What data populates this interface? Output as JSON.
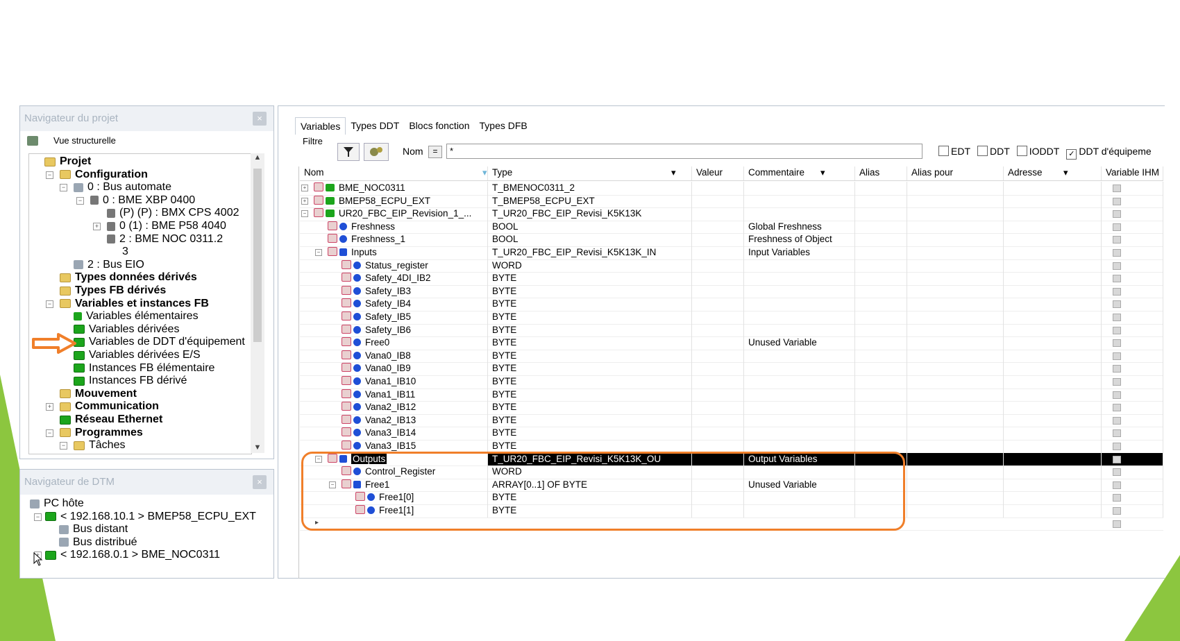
{
  "project_nav": {
    "title": "Navigateur du projet",
    "close": "×",
    "view_label": "Vue structurelle",
    "nodes": [
      {
        "label": "Projet",
        "bold": true
      },
      {
        "label": "Configuration",
        "bold": true
      },
      {
        "label": "0 : Bus automate"
      },
      {
        "label": "0 : BME XBP 0400"
      },
      {
        "label": "(P) (P) : BMX CPS 4002"
      },
      {
        "label": "0 (1) : BME P58 4040"
      },
      {
        "label": "2 : BME NOC 0311.2"
      },
      {
        "label": "3"
      },
      {
        "label": "2 : Bus EIO"
      },
      {
        "label": "Types données dérivés",
        "bold": true
      },
      {
        "label": "Types FB dérivés",
        "bold": true
      },
      {
        "label": "Variables et instances FB",
        "bold": true
      },
      {
        "label": "Variables élémentaires"
      },
      {
        "label": "Variables dérivées"
      },
      {
        "label": "Variables de DDT d'équipement"
      },
      {
        "label": "Variables dérivées E/S"
      },
      {
        "label": "Instances FB élémentaire"
      },
      {
        "label": "Instances FB dérivé"
      },
      {
        "label": "Mouvement",
        "bold": true
      },
      {
        "label": "Communication",
        "bold": true
      },
      {
        "label": "Réseau Ethernet",
        "bold": true
      },
      {
        "label": "Programmes",
        "bold": true
      },
      {
        "label": "Tâches"
      }
    ]
  },
  "dtm_nav": {
    "title": "Navigateur de DTM",
    "close": "×",
    "nodes": [
      {
        "label": "PC hôte"
      },
      {
        "label": "< 192.168.10.1 > BMEP58_ECPU_EXT"
      },
      {
        "label": "Bus distant"
      },
      {
        "label": "Bus distribué"
      },
      {
        "label": "< 192.168.0.1 > BME_NOC0311"
      }
    ]
  },
  "editor": {
    "tabs": [
      "Variables",
      "Types DDT",
      "Blocs fonction",
      "Types DFB"
    ],
    "filter_label": "Filtre",
    "name_label": "Nom",
    "equals": "=",
    "filter_value": "*",
    "checkboxes": [
      {
        "label": "EDT",
        "checked": false
      },
      {
        "label": "DDT",
        "checked": false
      },
      {
        "label": "IODDT",
        "checked": false
      },
      {
        "label": "DDT d'équipeme",
        "checked": true
      }
    ],
    "columns": [
      "Nom",
      "Type",
      "Valeur",
      "Commentaire",
      "Alias",
      "Alias pour",
      "Adresse",
      "Variable IHM"
    ],
    "rows": [
      {
        "name": "BME_NOC0311",
        "type": "T_BMENOC0311_2",
        "comment": "",
        "level": 0,
        "exp": "+",
        "icon": "green"
      },
      {
        "name": "BMEP58_ECPU_EXT",
        "type": "T_BMEP58_ECPU_EXT",
        "comment": "",
        "level": 0,
        "exp": "+",
        "icon": "green"
      },
      {
        "name": "UR20_FBC_EIP_Revision_1_...",
        "type": "T_UR20_FBC_EIP_Revisi_K5K13K",
        "comment": "",
        "level": 0,
        "exp": "-",
        "icon": "green"
      },
      {
        "name": "Freshness",
        "type": "BOOL",
        "comment": "Global Freshness",
        "level": 1,
        "icon": "dot"
      },
      {
        "name": "Freshness_1",
        "type": "BOOL",
        "comment": "Freshness of Object",
        "level": 1,
        "icon": "dot"
      },
      {
        "name": "Inputs",
        "type": "T_UR20_FBC_EIP_Revisi_K5K13K_IN",
        "comment": "Input Variables",
        "level": 1,
        "exp": "-",
        "icon": "sq"
      },
      {
        "name": "Status_register",
        "type": "WORD",
        "comment": "",
        "level": 2,
        "icon": "dot"
      },
      {
        "name": "Safety_4DI_IB2",
        "type": "BYTE",
        "comment": "",
        "level": 2,
        "icon": "dot"
      },
      {
        "name": "Safety_IB3",
        "type": "BYTE",
        "comment": "",
        "level": 2,
        "icon": "dot"
      },
      {
        "name": "Safety_IB4",
        "type": "BYTE",
        "comment": "",
        "level": 2,
        "icon": "dot"
      },
      {
        "name": "Safety_IB5",
        "type": "BYTE",
        "comment": "",
        "level": 2,
        "icon": "dot"
      },
      {
        "name": "Safety_IB6",
        "type": "BYTE",
        "comment": "",
        "level": 2,
        "icon": "dot"
      },
      {
        "name": "Free0",
        "type": "BYTE",
        "comment": "Unused Variable",
        "level": 2,
        "icon": "dot"
      },
      {
        "name": "Vana0_IB8",
        "type": "BYTE",
        "comment": "",
        "level": 2,
        "icon": "dot"
      },
      {
        "name": "Vana0_IB9",
        "type": "BYTE",
        "comment": "",
        "level": 2,
        "icon": "dot"
      },
      {
        "name": "Vana1_IB10",
        "type": "BYTE",
        "comment": "",
        "level": 2,
        "icon": "dot"
      },
      {
        "name": "Vana1_IB11",
        "type": "BYTE",
        "comment": "",
        "level": 2,
        "icon": "dot"
      },
      {
        "name": "Vana2_IB12",
        "type": "BYTE",
        "comment": "",
        "level": 2,
        "icon": "dot"
      },
      {
        "name": "Vana2_IB13",
        "type": "BYTE",
        "comment": "",
        "level": 2,
        "icon": "dot"
      },
      {
        "name": "Vana3_IB14",
        "type": "BYTE",
        "comment": "",
        "level": 2,
        "icon": "dot"
      },
      {
        "name": "Vana3_IB15",
        "type": "BYTE",
        "comment": "",
        "level": 2,
        "icon": "dot"
      },
      {
        "name": "Outputs",
        "type": "T_UR20_FBC_EIP_Revisi_K5K13K_OU",
        "comment": "Output Variables",
        "level": 1,
        "exp": "-",
        "icon": "sq",
        "selected": true
      },
      {
        "name": "Control_Register",
        "type": "WORD",
        "comment": "",
        "level": 2,
        "icon": "dot"
      },
      {
        "name": "Free1",
        "type": "ARRAY[0..1] OF BYTE",
        "comment": "Unused Variable",
        "level": 2,
        "exp": "-",
        "icon": "sq"
      },
      {
        "name": "Free1[0]",
        "type": "BYTE",
        "comment": "",
        "level": 3,
        "icon": "dot"
      },
      {
        "name": "Free1[1]",
        "type": "BYTE",
        "comment": "",
        "level": 3,
        "icon": "dot"
      }
    ],
    "new_row_marker": "▸"
  },
  "colors": {
    "highlight": "#f07f2a",
    "accent_green": "#8cc63f",
    "selected_bg": "#000000"
  }
}
